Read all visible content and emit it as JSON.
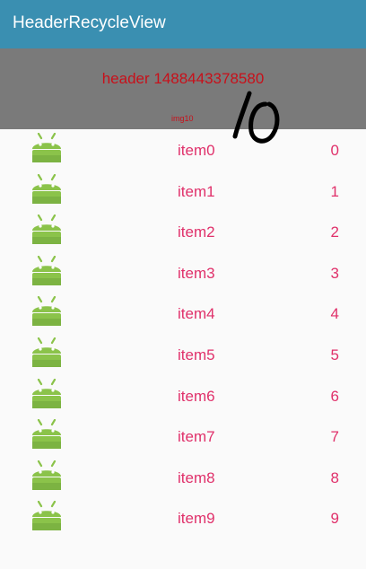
{
  "app_bar": {
    "title": "HeaderRecycleView",
    "color": "#3a8fb1"
  },
  "header": {
    "title": "header 1488443378580",
    "image_label": "img10",
    "handwriting": "10",
    "background": "#7a7a7a",
    "text_color": "#c8101a"
  },
  "list": {
    "icon": "android-icon",
    "text_color": "#e0306a",
    "items": [
      {
        "label": "item0",
        "value": "0"
      },
      {
        "label": "item1",
        "value": "1"
      },
      {
        "label": "item2",
        "value": "2"
      },
      {
        "label": "item3",
        "value": "3"
      },
      {
        "label": "item4",
        "value": "4"
      },
      {
        "label": "item5",
        "value": "5"
      },
      {
        "label": "item6",
        "value": "6"
      },
      {
        "label": "item7",
        "value": "7"
      },
      {
        "label": "item8",
        "value": "8"
      },
      {
        "label": "item9",
        "value": "9"
      }
    ]
  }
}
